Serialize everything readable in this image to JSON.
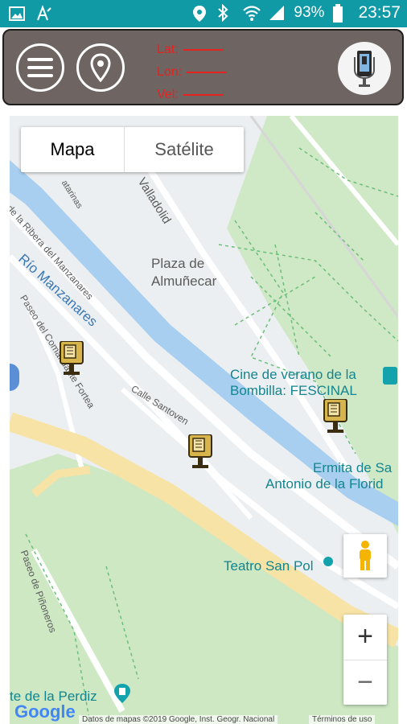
{
  "status_bar": {
    "battery_percent": "93%",
    "time": "23:57"
  },
  "header": {
    "lat_label": "Lat:",
    "lon_label": "Lon:",
    "vel_label": "Vel:"
  },
  "map": {
    "type_options": [
      "Mapa",
      "Satélite"
    ],
    "selected_type": "Mapa",
    "labels": {
      "river": "Río Manzanares",
      "plaza": [
        "Plaza de",
        "Almuñecar"
      ],
      "valladolid": "Valladolid",
      "ribera": "de la Ribera del Manzanares",
      "paseo_fortea": "Paseo del Comandante Fortea",
      "calle_santoven": "Calle Santoven",
      "paseo_pinoneros": "Paseo de Piñoneros",
      "catarinas": "atarinas",
      "cine": [
        "Cine de verano de la",
        "Bombilla: FESCINAL"
      ],
      "ermita": [
        "Ermita de Sa",
        "Antonio de la Florid"
      ],
      "teatro": "Teatro San Pol",
      "perdiz": "te de la Perdiz",
      "google": "Google",
      "attribution": "Datos de mapas ©2019 Google, Inst. Geogr. Nacional",
      "terms": "Términos de uso"
    },
    "zoom_in": "+",
    "zoom_out": "−"
  },
  "colors": {
    "status_bar": "#0f9aa6",
    "header_bg": "#6e6563",
    "coords_red": "#e4231f",
    "river": "#a8cff0",
    "park": "#cde8c3",
    "road_yellow": "#f7e3a6",
    "poi_teal": "#13858f"
  }
}
